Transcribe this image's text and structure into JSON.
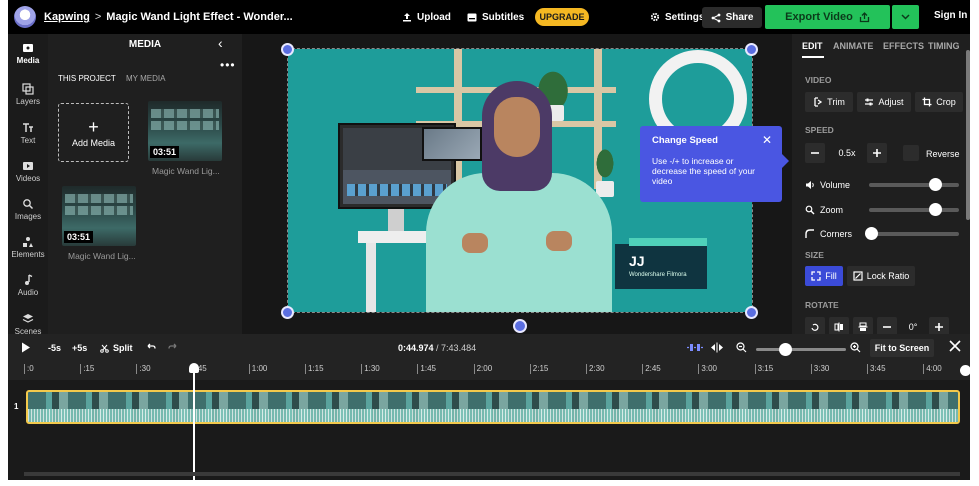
{
  "topbar": {
    "brand": "Kapwing",
    "separator": ">",
    "project_title": "Magic Wand Light Effect - Wonder...",
    "upload_label": "Upload",
    "subtitles_label": "Subtitles",
    "upgrade_label": "UPGRADE",
    "settings_label": "Settings",
    "share_label": "Share",
    "export_label": "Export Video",
    "signin_label": "Sign In",
    "colors": {
      "export": "#23c25a",
      "upgrade": "#f5b822",
      "accent": "#4a56e2"
    }
  },
  "rail": {
    "items": [
      {
        "label": "Media",
        "icon": "media-icon"
      },
      {
        "label": "Layers",
        "icon": "layers-icon"
      },
      {
        "label": "Text",
        "icon": "text-icon"
      },
      {
        "label": "Videos",
        "icon": "videos-icon"
      },
      {
        "label": "Images",
        "icon": "images-icon"
      },
      {
        "label": "Elements",
        "icon": "elements-icon"
      },
      {
        "label": "Audio",
        "icon": "audio-icon"
      },
      {
        "label": "Scenes",
        "icon": "scenes-icon"
      }
    ]
  },
  "media": {
    "title": "MEDIA",
    "tabs": [
      "THIS PROJECT",
      "MY MEDIA"
    ],
    "add_label": "Add Media",
    "items": [
      {
        "duration": "03:51",
        "name": "Magic Wand Lig..."
      },
      {
        "duration": "03:51",
        "name": "Magic Wand Lig..."
      }
    ]
  },
  "canvas": {
    "lower_third_name": "JJ",
    "lower_third_sub": "Wondershare Filmora"
  },
  "tooltip": {
    "title": "Change Speed",
    "body": "Use -/+ to increase or decrease the speed of your video",
    "close": "✕"
  },
  "rpanel": {
    "tabs": [
      "EDIT",
      "ANIMATE",
      "EFFECTS",
      "TIMING"
    ],
    "video_label": "VIDEO",
    "trim_label": "Trim",
    "adjust_label": "Adjust",
    "crop_label": "Crop",
    "speed_label": "SPEED",
    "speed_value": "0.5x",
    "reverse_label": "Reverse",
    "volume_label": "Volume",
    "zoom_label": "Zoom",
    "corners_label": "Corners",
    "size_label": "SIZE",
    "fill_label": "Fill",
    "lock_ratio_label": "Lock Ratio",
    "rotate_label": "ROTATE",
    "rotate_value": "0°",
    "sliders": {
      "volume": 0.73,
      "zoom": 0.73,
      "corners": 0.02
    }
  },
  "timeline": {
    "back5": "-5s",
    "fwd5": "+5s",
    "split": "Split",
    "current_time": "0:44.974",
    "total_time": "/ 7:43.484",
    "fit_label": "Fit to Screen",
    "track_number": "1",
    "ticks": [
      ":0",
      ":15",
      ":30",
      ":45",
      "1:00",
      "1:15",
      "1:30",
      "1:45",
      "2:00",
      "2:15",
      "2:30",
      "2:45",
      "3:00",
      "3:15",
      "3:30",
      "3:45",
      "4:00"
    ]
  }
}
